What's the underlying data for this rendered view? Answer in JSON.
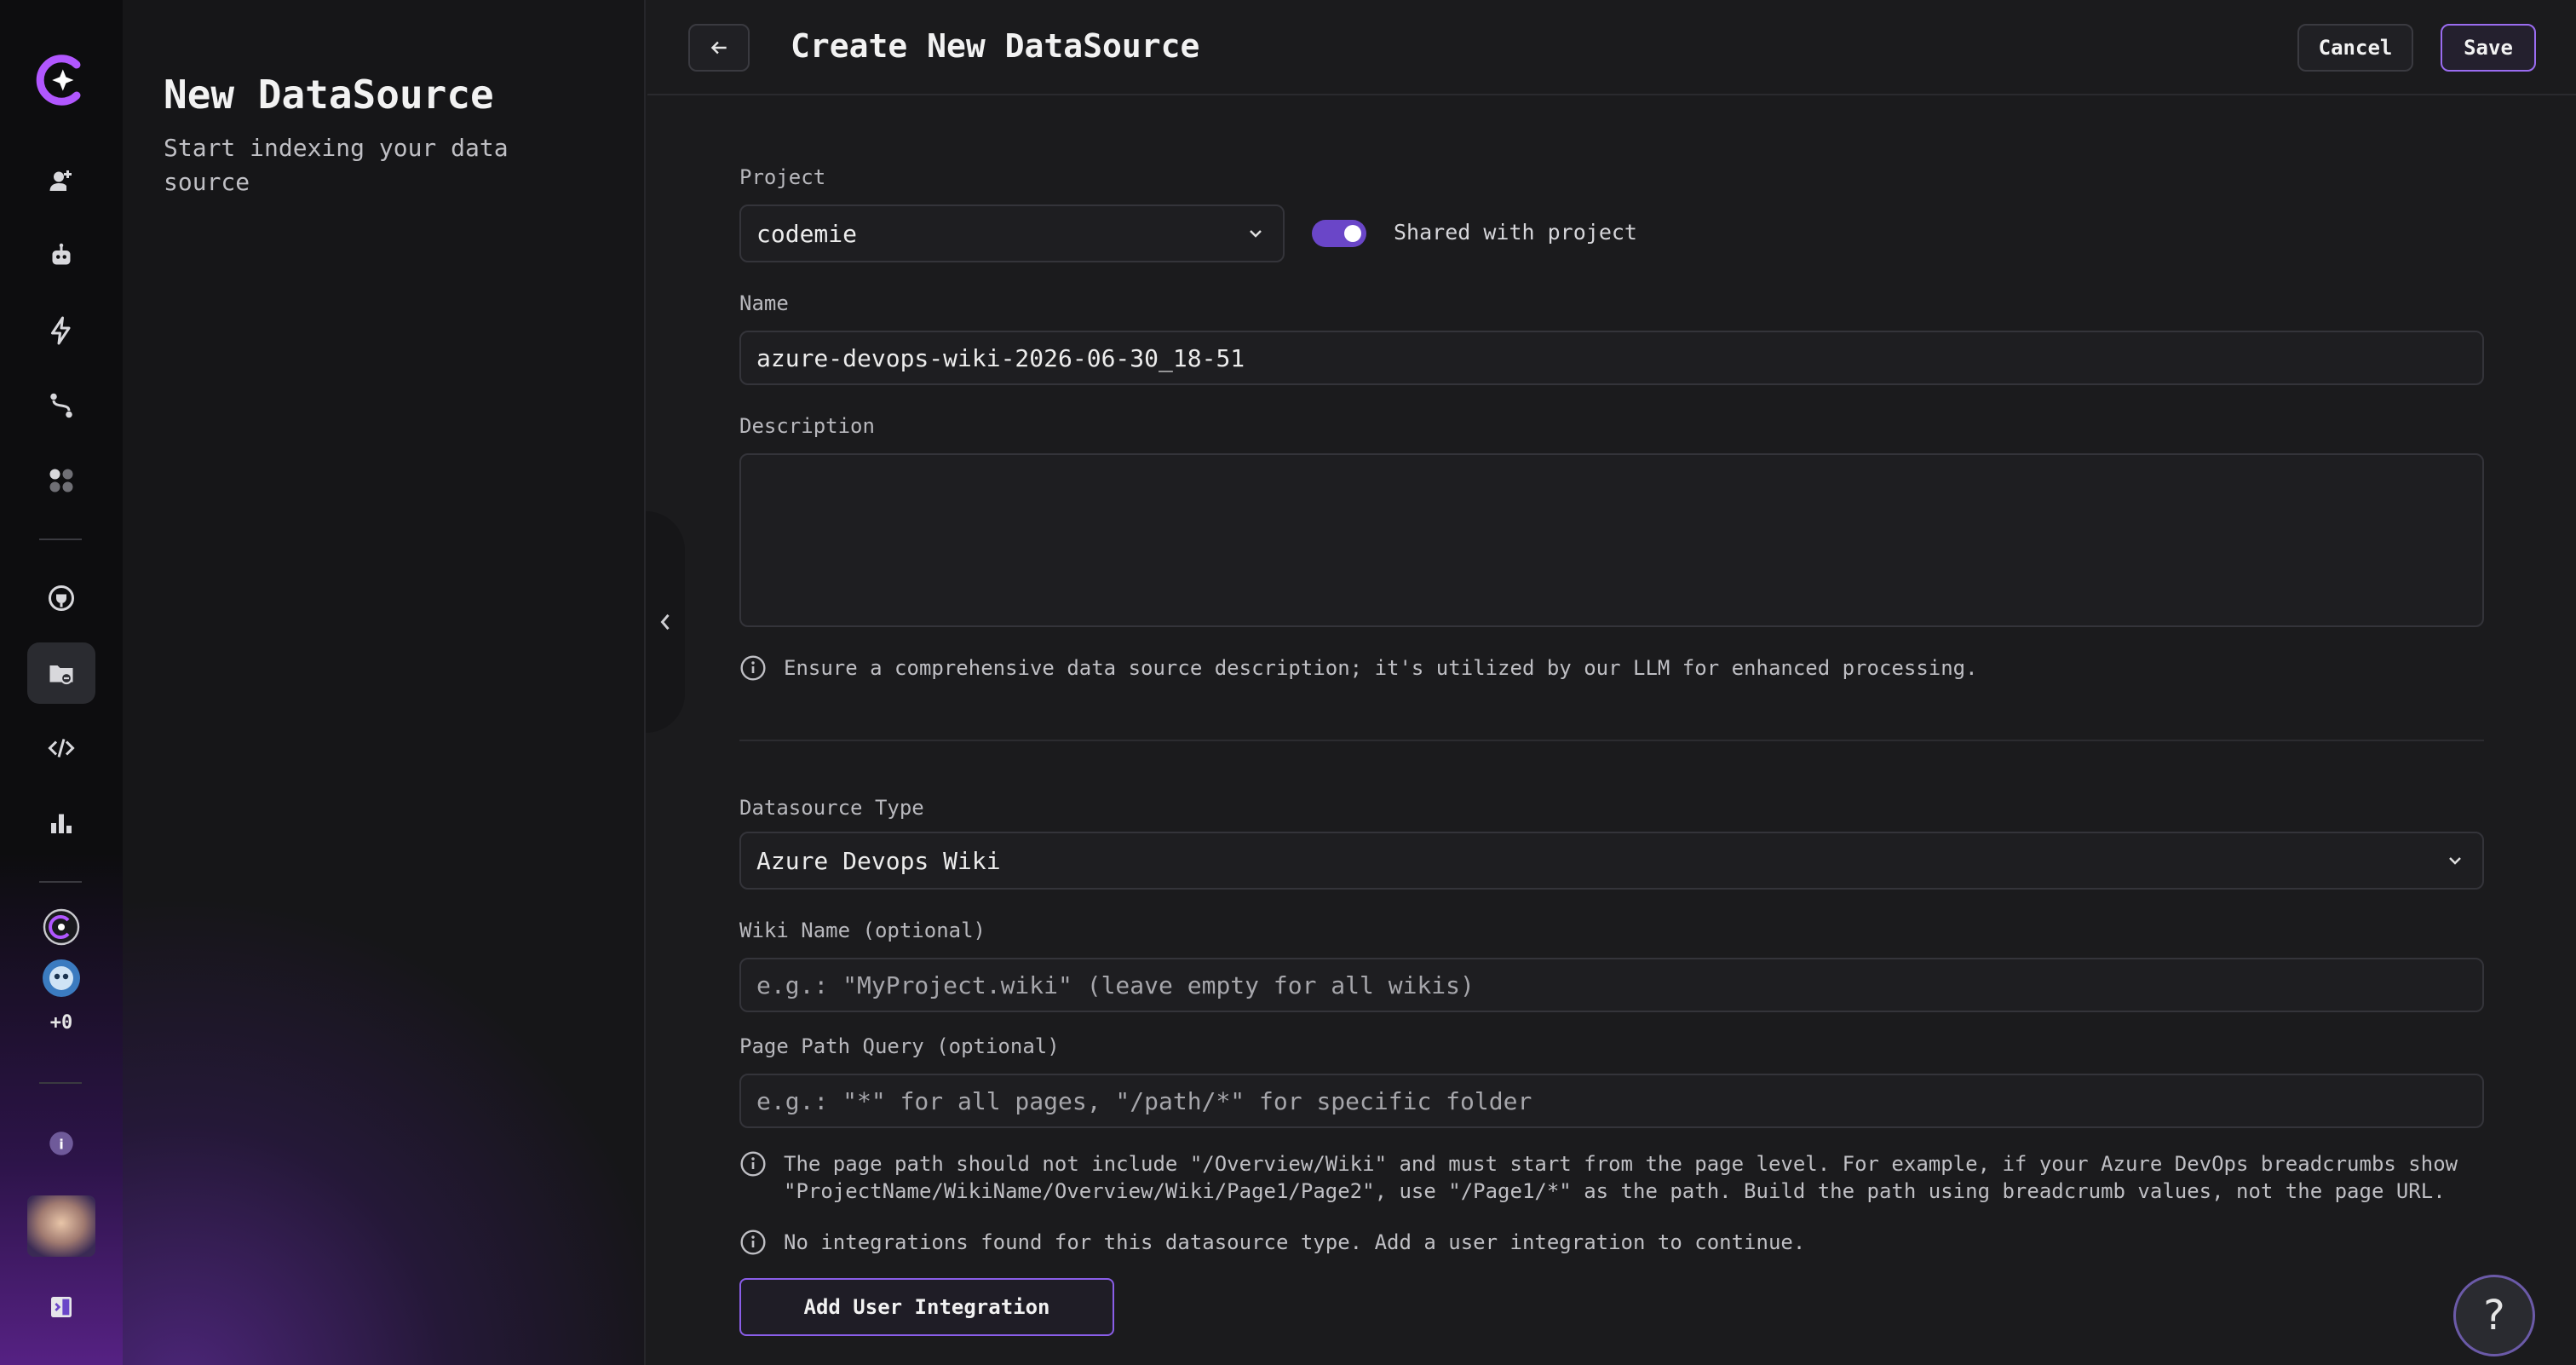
{
  "rail": {
    "brand_colors": [
      "#a64dff",
      "#6a46c8"
    ],
    "items": [
      {
        "icon": "assistant-add-icon"
      },
      {
        "icon": "robot-icon"
      },
      {
        "icon": "lightning-icon"
      },
      {
        "icon": "workflow-icon"
      },
      {
        "icon": "apps-grid-icon"
      },
      {
        "icon": "integration-icon"
      },
      {
        "icon": "folder-datasource-icon",
        "active": true
      },
      {
        "icon": "code-icon"
      },
      {
        "icon": "analytics-icon"
      }
    ],
    "count_label": "+0",
    "info_badge": "i"
  },
  "panel": {
    "title": "New DataSource",
    "subtitle": "Start indexing your data source"
  },
  "header": {
    "title": "Create New DataSource",
    "cancel_label": "Cancel",
    "save_label": "Save"
  },
  "form": {
    "project": {
      "label": "Project",
      "value": "codemie"
    },
    "shared": {
      "label": "Shared with project",
      "enabled": true
    },
    "name": {
      "label": "Name",
      "value": "azure-devops-wiki-2026-06-30_18-51"
    },
    "description": {
      "label": "Description",
      "value": "",
      "hint": "Ensure a comprehensive data source description; it's utilized by our LLM for enhanced processing."
    },
    "datasource_type": {
      "label": "Datasource Type",
      "value": "Azure Devops Wiki"
    },
    "wiki_name": {
      "label": "Wiki Name (optional)",
      "placeholder": "e.g.: \"MyProject.wiki\" (leave empty for all wikis)"
    },
    "page_path": {
      "label": "Page Path Query (optional)",
      "placeholder": "e.g.: \"*\" for all pages, \"/path/*\" for specific folder",
      "hint_line1": "The page path should not include \"/Overview/Wiki\" and must start from the page level. For example, if your Azure DevOps breadcrumbs show",
      "hint_line2": "\"ProjectName/WikiName/Overview/Wiki/Page1/Page2\", use \"/Page1/*\" as the path. Build the path using breadcrumb values, not the page URL."
    },
    "integration_notice": "No integrations found for this datasource type. Add a user integration to continue.",
    "add_integration_label": "Add User Integration"
  },
  "help": {
    "label": "?"
  }
}
